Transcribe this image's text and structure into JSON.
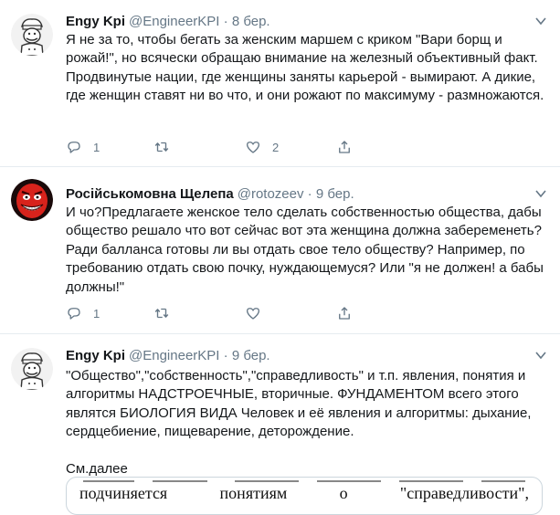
{
  "tweets": [
    {
      "name": "Engy Kpi",
      "handle": "@EngineerKPI",
      "separator": "·",
      "date": "8 бер.",
      "avatar_icon": "chef-avatar-icon",
      "text": "Я не за то, чтобы бегать за женским маршем с криком \"Вари борщ и рожай!\", но всячески обращаю внимание на железный объективный факт. Продвинутые нации, где женщины заняты карьерой - вымирают. А дикие, где женщин ставят ни во что, и они рожают по максимуму - размножаются.",
      "reply_count": "1",
      "retweet_count": "",
      "like_count": "2"
    },
    {
      "name": "Російськомовна Щелепа",
      "handle": "@rotozeev",
      "separator": "·",
      "date": "9 бер.",
      "avatar_icon": "red-face-avatar-icon",
      "text": "И чо?Предлагаете женское тело сделать собственностью общества, дабы общество решало что вот сейчас вот эта женщина должна забеременеть? Ради балланса готовы ли вы отдать свое тело обществу? Например, по требованию отдать свою почку, нуждающемуся? Или \"я не должен! а бабы должны!\"",
      "reply_count": "1",
      "retweet_count": "",
      "like_count": ""
    },
    {
      "name": "Engy Kpi",
      "handle": "@EngineerKPI",
      "separator": "·",
      "date": "9 бер.",
      "avatar_icon": "chef-avatar-icon",
      "text": "\"Общество\",\"собственность\",\"справедливость\" и т.п. явления, понятия и алгоритмы НАДСТРОЕЧНЫЕ, вторичные. ФУНДАМЕНТОМ всего этого являтся БИОЛОГИЯ ВИДА Человек и её явления и алгоритмы: дыхание, сердцебиение, пищеварение, деторождение.",
      "text2": "См.далее",
      "embed_words": [
        "подчиняется",
        "понятиям",
        "о",
        "\"справедливости\","
      ]
    }
  ],
  "colors": {
    "text": "#14171a",
    "muted": "#657786",
    "divider": "#e6ecf0"
  }
}
